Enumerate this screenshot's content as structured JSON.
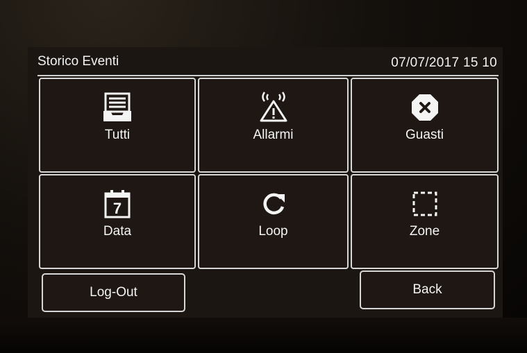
{
  "header": {
    "title": "Storico Eventi",
    "datetime": "07/07/2017 15 10"
  },
  "tiles": [
    {
      "label": "Tutti",
      "icon": "inbox-tray-icon"
    },
    {
      "label": "Allarmi",
      "icon": "alarm-warning-icon"
    },
    {
      "label": "Guasti",
      "icon": "fault-octagon-x-icon"
    },
    {
      "label": "Data",
      "icon": "calendar-icon",
      "icon_text": "7"
    },
    {
      "label": "Loop",
      "icon": "loop-refresh-icon"
    },
    {
      "label": "Zone",
      "icon": "zone-dashed-square-icon"
    }
  ],
  "footer": {
    "logout_label": "Log-Out",
    "back_label": "Back"
  },
  "colors": {
    "screen_bg": "#1c1613",
    "outline": "#d6d6d6",
    "text": "#f4f4f4"
  }
}
